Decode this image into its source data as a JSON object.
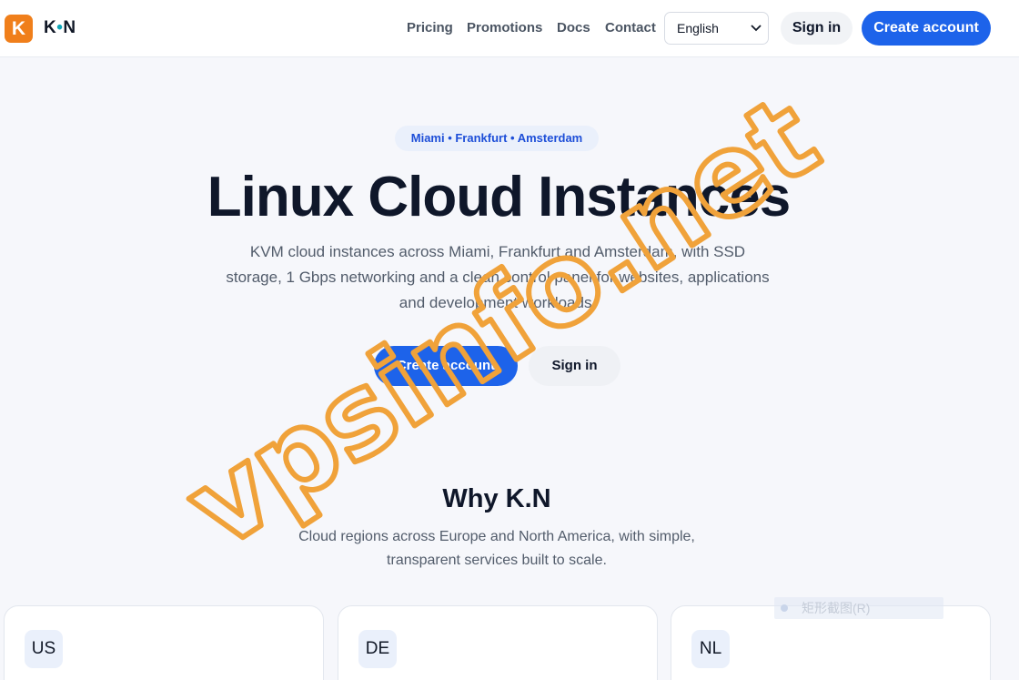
{
  "header": {
    "logo_letter": "K",
    "logo_text_left": "K",
    "logo_text_dot": "•",
    "logo_text_right": "N",
    "nav": [
      "Pricing",
      "Promotions",
      "Docs",
      "Contact"
    ],
    "language": "English",
    "signin_label": "Sign in",
    "create_label": "Create account"
  },
  "hero": {
    "locations": "Miami • Frankfurt • Amsterdam",
    "title": "Linux Cloud Instances",
    "description": "KVM cloud instances across Miami, Frankfurt and Amsterdam, with SSD storage, 1 Gbps networking and a clean control panel for websites, applications and development workloads.",
    "create_label": "Create account",
    "signin_label": "Sign in"
  },
  "why": {
    "title": "Why K.N",
    "description": "Cloud regions across Europe and North America, with simple, transparent services built to scale."
  },
  "regions": [
    "US",
    "DE",
    "NL"
  ],
  "overlay": {
    "tooltip_text": "矩形截图(R)",
    "watermark_text": "vpsinfo.net"
  },
  "colors": {
    "brand_orange": "#f07f1b",
    "accent_blue": "#1d63ea",
    "watermark_orange": "#f0a23a"
  }
}
